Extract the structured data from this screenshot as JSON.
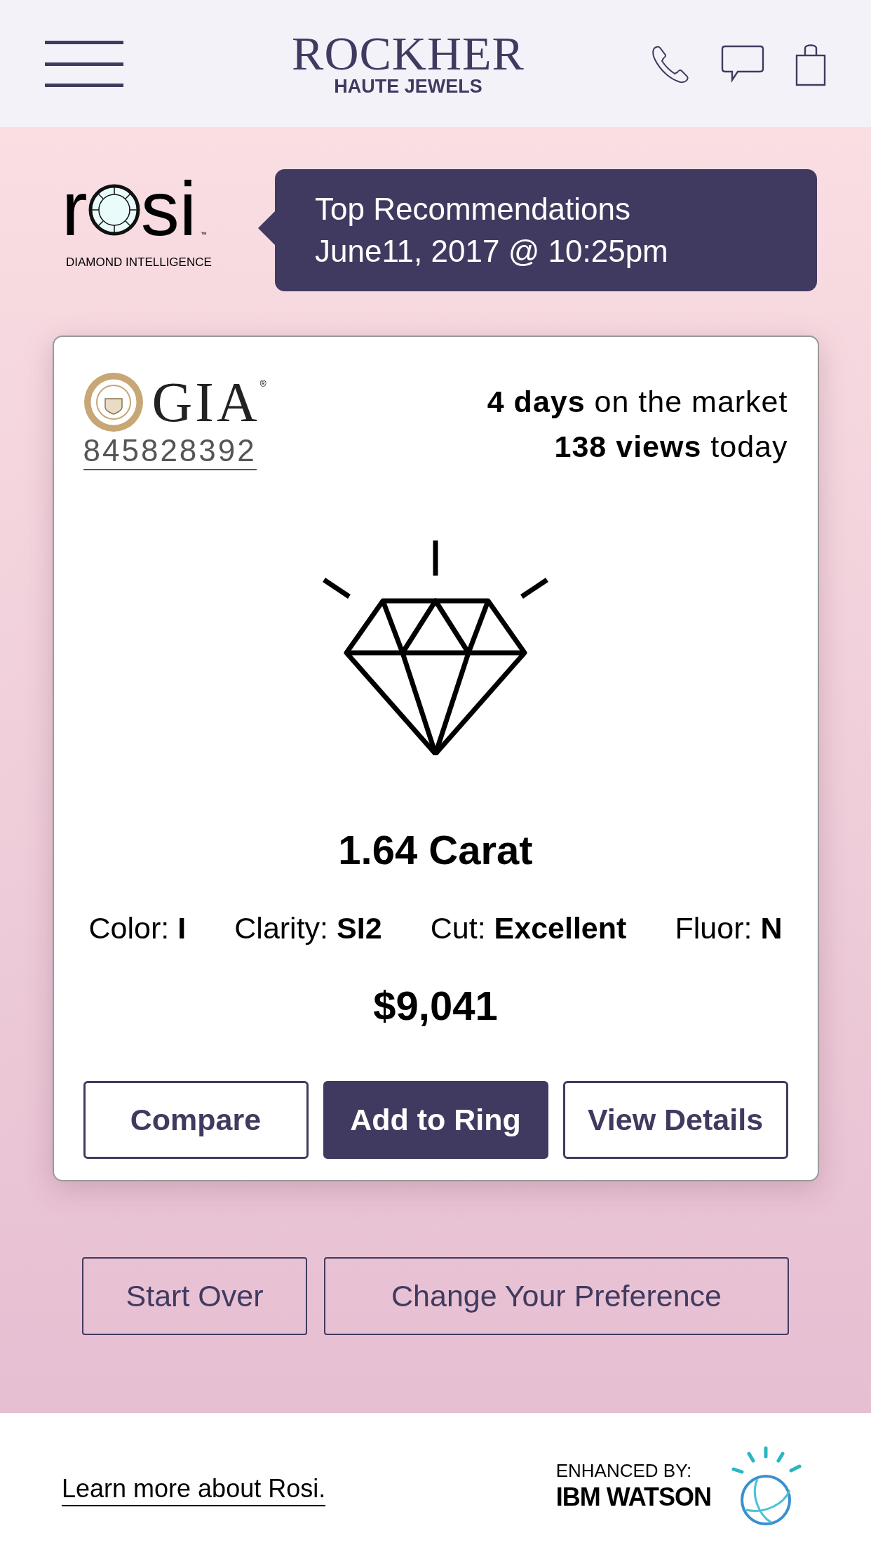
{
  "header": {
    "brand": "ROCKHER",
    "subtitle": "HAUTE JEWELS"
  },
  "rosi_logo": {
    "before_o": "r",
    "after_o": "si",
    "trademark": "™",
    "tagline": "DIAMOND INTELLIGENCE"
  },
  "recommendation_bubble": {
    "title": "Top Recommendations",
    "timestamp": "June11, 2017 @ 10:25pm"
  },
  "diamond_card": {
    "lab": "GIA",
    "lab_mark": "®",
    "certificate_number": "845828392",
    "stats": [
      "**4 days** on the market",
      "**138 views** today"
    ],
    "carat": "1.64 Carat",
    "specs": [
      "Color: **I**",
      "Clarity: **SI2**",
      "Cut: **Excellent**",
      "Fluor: **N**"
    ],
    "price": "$9,041",
    "buttons": [
      {
        "label": "Compare",
        "kind": "outline"
      },
      {
        "label": "Add to Ring",
        "kind": "filled"
      },
      {
        "label": "View Details",
        "kind": "outline"
      }
    ]
  },
  "actions": [
    "Start Over",
    "Change Your Preference"
  ],
  "footer": {
    "link": "Learn more about Rosi.",
    "enhanced_by": "ENHANCED BY:",
    "partner": "IBM WATSON"
  }
}
